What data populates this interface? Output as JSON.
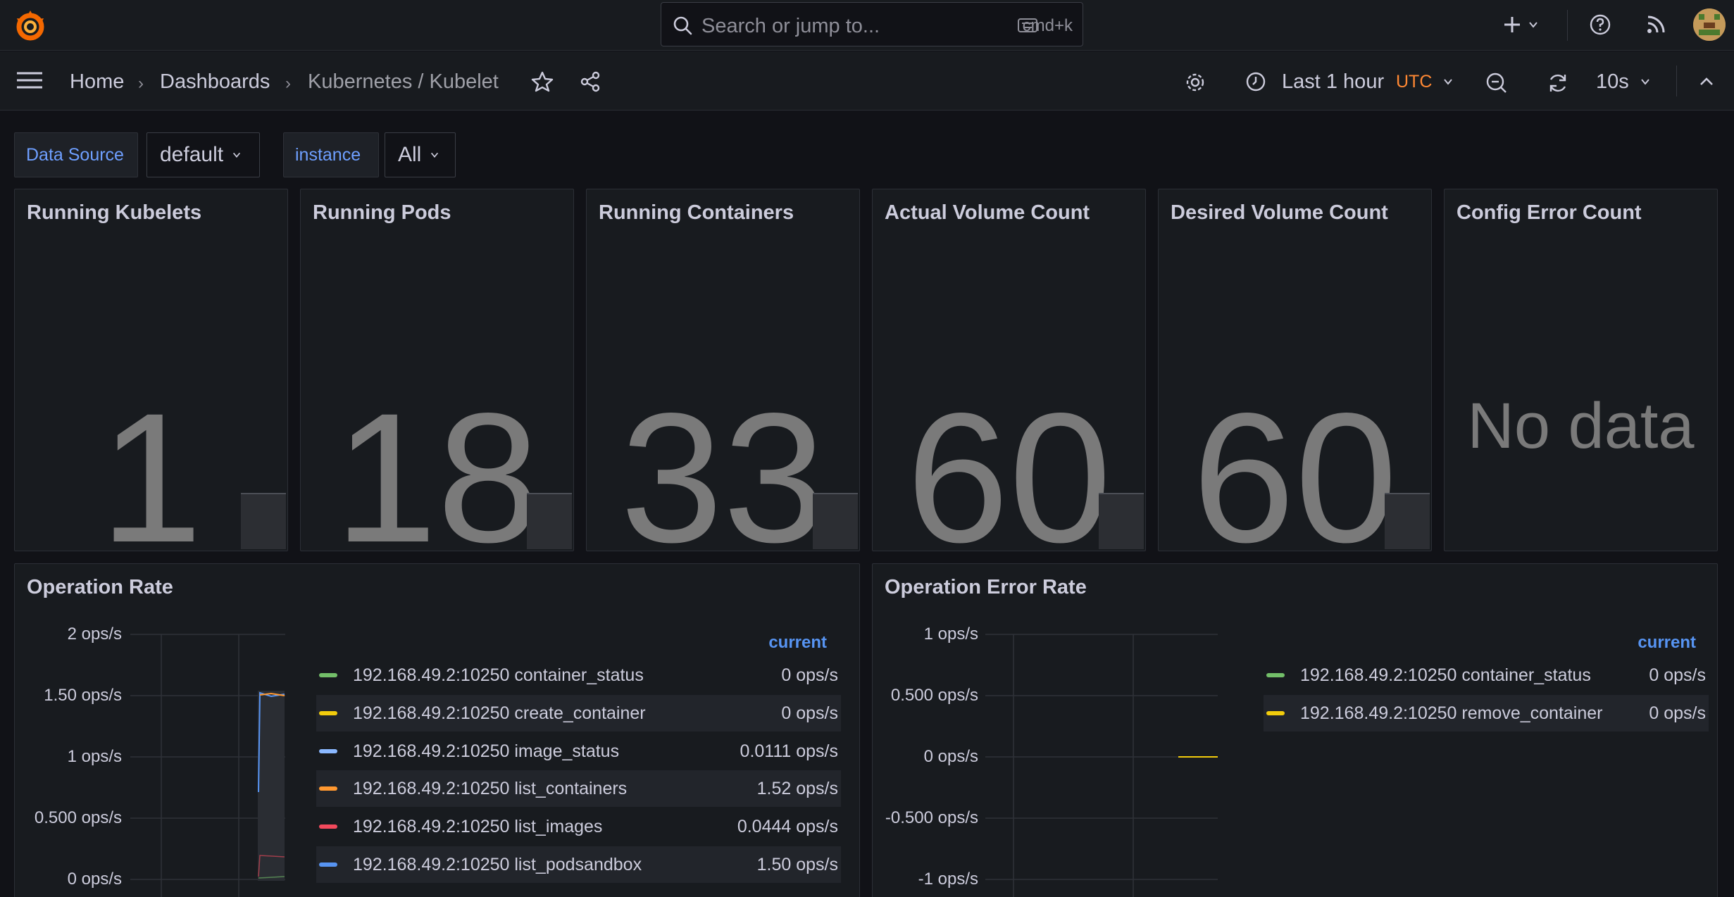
{
  "topbar": {
    "search_placeholder": "Search or jump to...",
    "search_shortcut": "cmd+k"
  },
  "breadcrumbs": [
    "Home",
    "Dashboards",
    "Kubernetes / Kubelet"
  ],
  "timepicker": {
    "range": "Last 1 hour",
    "timezone": "UTC",
    "refresh_interval": "10s"
  },
  "variables": [
    {
      "label": "Data Source",
      "value": "default"
    },
    {
      "label": "instance",
      "value": "All"
    }
  ],
  "stat_panels": [
    {
      "title": "Running Kubelets",
      "value": "1"
    },
    {
      "title": "Running Pods",
      "value": "18"
    },
    {
      "title": "Running Containers",
      "value": "33"
    },
    {
      "title": "Actual Volume Count",
      "value": "60"
    },
    {
      "title": "Desired Volume Count",
      "value": "60"
    },
    {
      "title": "Config Error Count",
      "value": "No data"
    }
  ],
  "operation_rate": {
    "title": "Operation Rate",
    "legend_header": "current",
    "y_ticks": [
      "2 ops/s",
      "1.50 ops/s",
      "1 ops/s",
      "0.500 ops/s",
      "0 ops/s"
    ],
    "series": [
      {
        "name": "192.168.49.2:10250 container_status",
        "current": "0 ops/s",
        "color": "#73bf69"
      },
      {
        "name": "192.168.49.2:10250 create_container",
        "current": "0 ops/s",
        "color": "#f2cc0c"
      },
      {
        "name": "192.168.49.2:10250 image_status",
        "current": "0.0111 ops/s",
        "color": "#8ab8ff"
      },
      {
        "name": "192.168.49.2:10250 list_containers",
        "current": "1.52 ops/s",
        "color": "#ff9830"
      },
      {
        "name": "192.168.49.2:10250 list_images",
        "current": "0.0444 ops/s",
        "color": "#f2495c"
      },
      {
        "name": "192.168.49.2:10250 list_podsandbox",
        "current": "1.50 ops/s",
        "color": "#5794f2"
      }
    ]
  },
  "operation_error_rate": {
    "title": "Operation Error Rate",
    "legend_header": "current",
    "y_ticks": [
      "1 ops/s",
      "0.500 ops/s",
      "0 ops/s",
      "-0.500 ops/s",
      "-1 ops/s"
    ],
    "series": [
      {
        "name": "192.168.49.2:10250 container_status",
        "current": "0 ops/s",
        "color": "#73bf69"
      },
      {
        "name": "192.168.49.2:10250 remove_container",
        "current": "0 ops/s",
        "color": "#f2cc0c"
      }
    ]
  }
}
